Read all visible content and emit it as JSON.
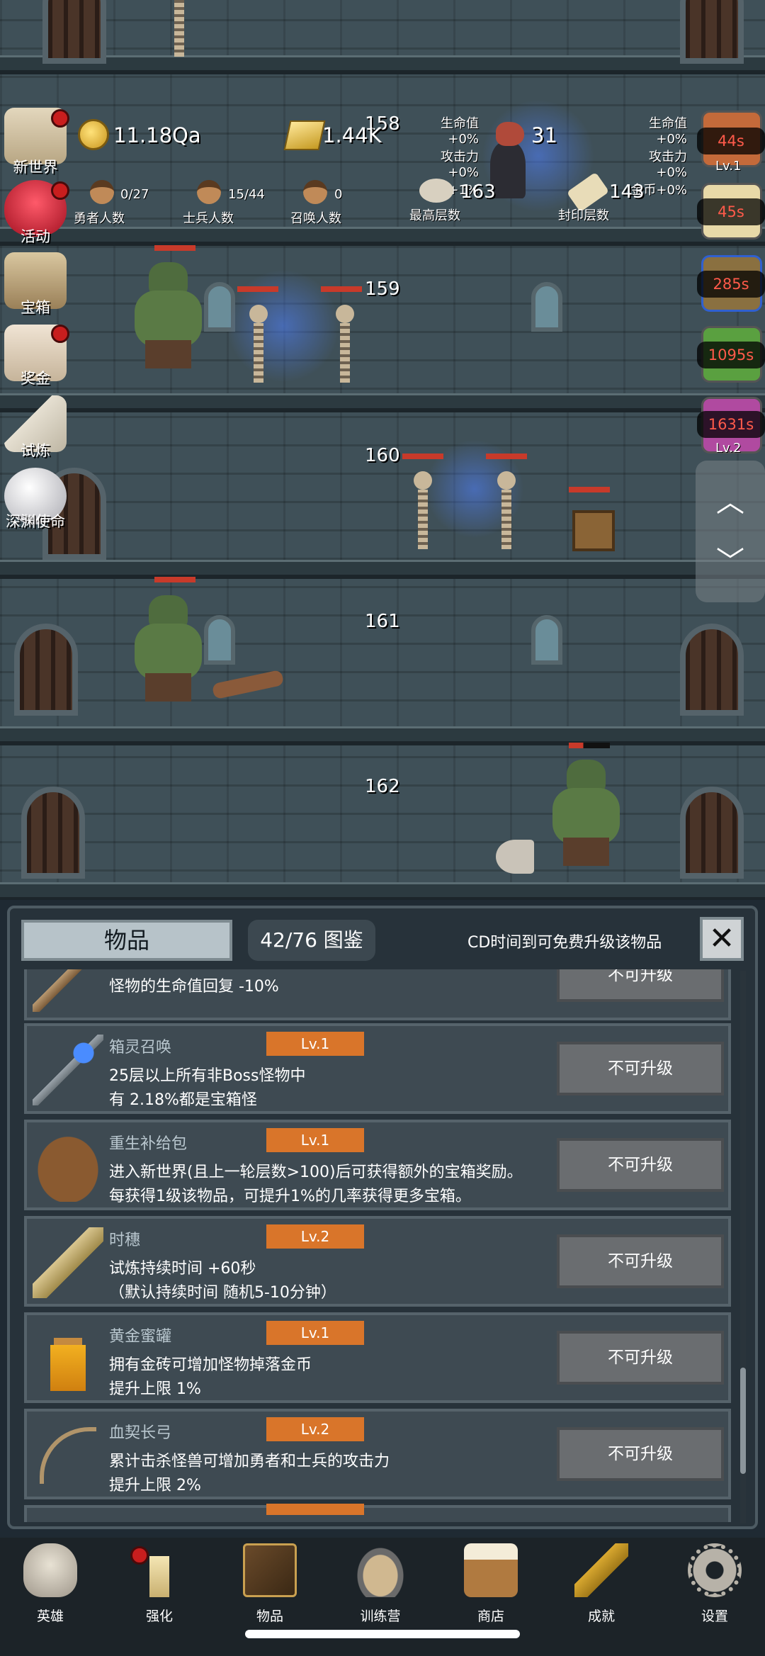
{
  "hud": {
    "coins": "11.18Qa",
    "gold": "1.44K",
    "meat": "31",
    "hero_count": "0/27",
    "hero_label": "勇者人数",
    "soldier_count": "15/44",
    "soldier_label": "士兵人数",
    "summon_count": "0",
    "summon_label": "召唤人数",
    "max_floor": "163",
    "max_floor_label": "最高层数",
    "seal_floor": "143",
    "seal_floor_label": "封印层数",
    "bonus_left": [
      "生命值+0%",
      "攻击力+0%",
      "金币+1%"
    ],
    "bonus_right": [
      "生命值+0%",
      "攻击力+0%",
      "金币+0%"
    ]
  },
  "floors": [
    "158",
    "159",
    "160",
    "161",
    "162"
  ],
  "left_menu": [
    {
      "label": "新世界",
      "dot": true
    },
    {
      "label": "活动",
      "dot": true
    },
    {
      "label": "宝箱",
      "dot": false
    },
    {
      "label": "奖金",
      "dot": true
    },
    {
      "label": "试炼",
      "dot": false
    },
    {
      "label": "深渊使命",
      "dot": false
    }
  ],
  "buffs": [
    "44s",
    "45s",
    "285s",
    "1095s",
    "1631s"
  ],
  "buff_levels": [
    "Lv.1",
    "Lv.2"
  ],
  "panel": {
    "title": "物品",
    "collection": "42/76 图鉴",
    "cd_text": "CD时间到可免费升级该物品",
    "close": "✕"
  },
  "items": [
    {
      "name": "",
      "level": "",
      "desc": [
        "怪物的生命值回复 -10%"
      ],
      "button": "不可升级"
    },
    {
      "name": "箱灵召唤",
      "level": "Lv.1",
      "desc": [
        "25层以上所有非Boss怪物中",
        "有 2.18%都是宝箱怪"
      ],
      "button": "不可升级"
    },
    {
      "name": "重生补给包",
      "level": "Lv.1",
      "desc": [
        "进入新世界(且上一轮层数>100)后可获得额外的宝箱奖励。",
        "每获得1级该物品，可提升1%的几率获得更多宝箱。"
      ],
      "button": "不可升级"
    },
    {
      "name": "时穗",
      "level": "Lv.2",
      "desc": [
        "试炼持续时间 +60秒",
        "（默认持续时间 随机5-10分钟）"
      ],
      "button": "不可升级"
    },
    {
      "name": "黄金蜜罐",
      "level": "Lv.1",
      "desc": [
        "拥有金砖可增加怪物掉落金币",
        "提升上限 1%"
      ],
      "button": "不可升级"
    },
    {
      "name": "血契长弓",
      "level": "Lv.2",
      "desc": [
        "累计击杀怪兽可增加勇者和士兵的攻击力",
        "提升上限 2%"
      ],
      "button": "不可升级"
    }
  ],
  "bottom_nav": [
    "英雄",
    "强化",
    "物品",
    "训练营",
    "商店",
    "成就",
    "设置"
  ],
  "colors": {
    "level_badge": "#d9752a",
    "panel_bg": "#27323a",
    "timer_red": "#ff5a4a"
  }
}
